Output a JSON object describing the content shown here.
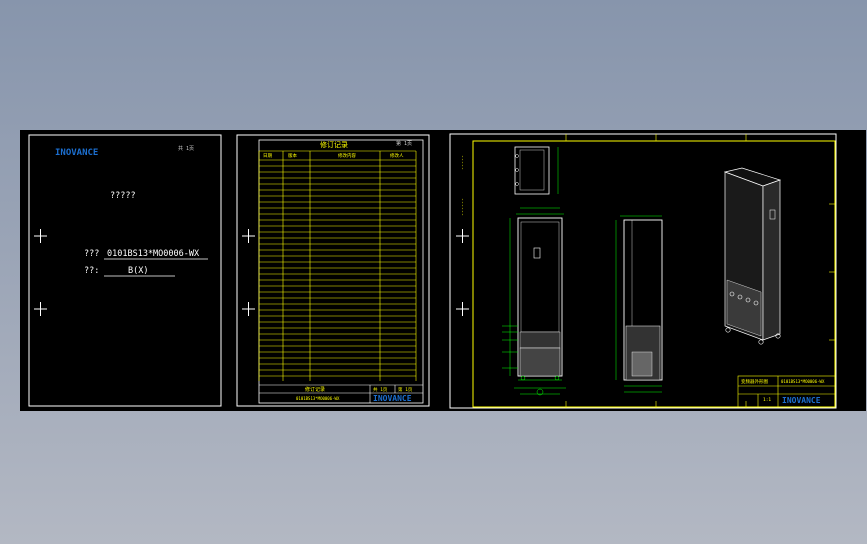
{
  "sheet1": {
    "brand": "INOVANCE",
    "page_no": "共  1页",
    "doc_title": "?????",
    "code_label": "???",
    "code_value": "0101BS13*MO0006-WX",
    "version_label": "??:",
    "version_value": "B(X)"
  },
  "sheet2": {
    "title": "修订记录",
    "page_no": "第 1页",
    "columns": [
      "日期",
      "版本",
      "修改内容",
      "修改人"
    ],
    "footer_doc": "0101BS13*MO0006-WX",
    "footer_left": "修订记录",
    "footer_mid": "共  1页",
    "footer_right": "第  1页",
    "brand": "INOVANCE"
  },
  "sheet3": {
    "brand": "INOVANCE",
    "title_block_name": "变频器外形图",
    "title_block_code": "0101BS13*MO0006-WX",
    "title_block_scale": "1:1"
  },
  "colors": {
    "frame": "#ffffff",
    "content": "#ffff00",
    "dimension": "#00ff00",
    "brand": "#1c6fd0",
    "background": "#000000"
  }
}
